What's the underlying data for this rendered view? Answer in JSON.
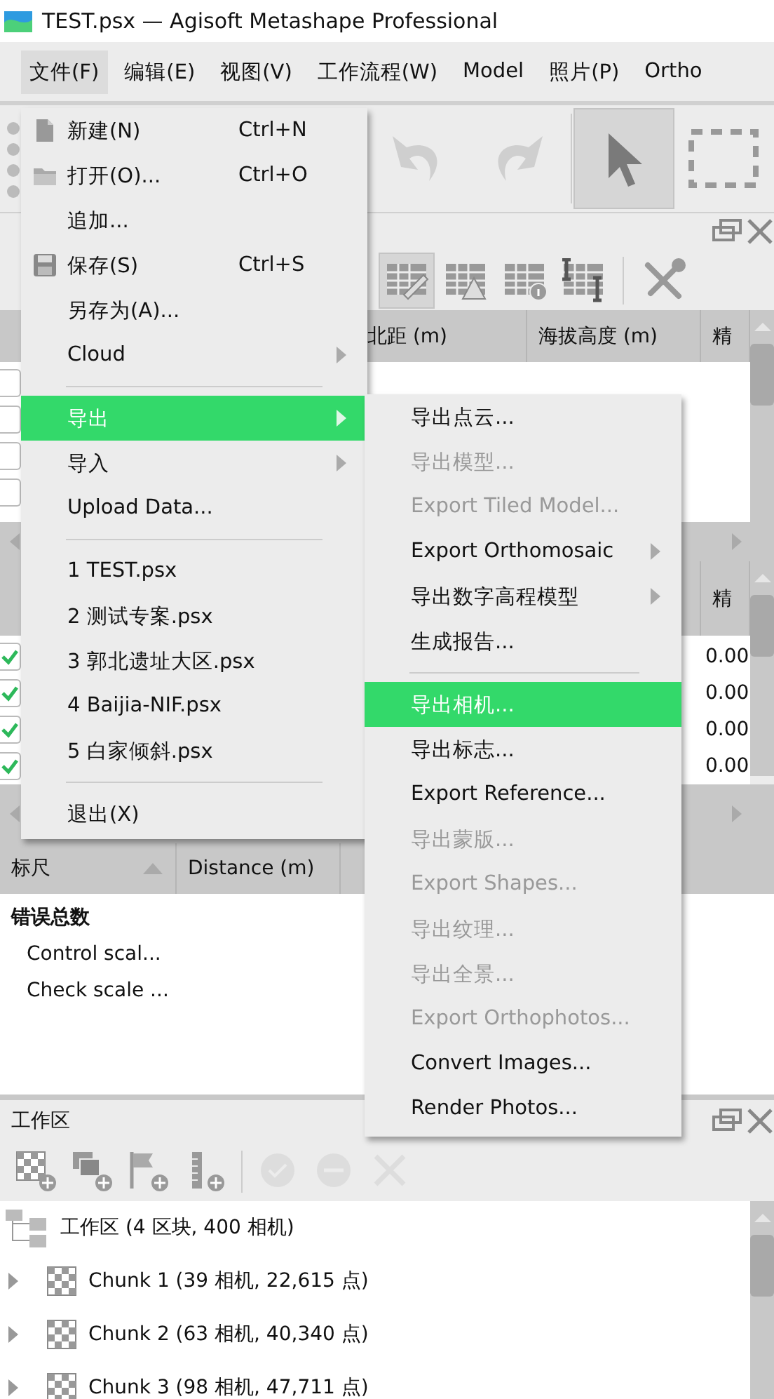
{
  "window": {
    "title": "TEST.psx — Agisoft Metashape Professional"
  },
  "menubar": [
    {
      "label": "文件(F)",
      "selected": true
    },
    {
      "label": "编辑(E)",
      "selected": false
    },
    {
      "label": "视图(V)",
      "selected": false
    },
    {
      "label": "工作流程(W)",
      "selected": false
    },
    {
      "label": "Model",
      "selected": false
    },
    {
      "label": "照片(P)",
      "selected": false
    },
    {
      "label": "Ortho",
      "selected": false
    }
  ],
  "toolbar": [
    {
      "kind": "undo",
      "selected": false
    },
    {
      "kind": "redo",
      "selected": false
    },
    {
      "kind": "separator"
    },
    {
      "kind": "pointer",
      "selected": true
    },
    {
      "kind": "rect-select",
      "selected": false
    }
  ],
  "reference_panel": {
    "toolbar": [
      {
        "kind": "edit",
        "selected": true
      },
      {
        "kind": "warning",
        "selected": false
      },
      {
        "kind": "info",
        "selected": false
      },
      {
        "kind": "columns",
        "selected": false
      },
      {
        "kind": "separator"
      },
      {
        "kind": "tools",
        "selected": false
      }
    ],
    "top_table": {
      "columns": [
        "北距 (m)",
        "海拔高度 (m)",
        "精"
      ],
      "rows": [
        {
          "checked": false
        },
        {
          "checked": false
        },
        {
          "checked": false
        },
        {
          "checked": false
        }
      ]
    },
    "bottom_table": {
      "columns": [
        "精"
      ],
      "rows": [
        {
          "checked": true,
          "column_2": "0.00"
        },
        {
          "checked": true,
          "column_2": "0.00"
        },
        {
          "checked": true,
          "column_2": "0.00"
        },
        {
          "checked": true,
          "column_2": "0.00"
        }
      ]
    }
  },
  "scale_panel": {
    "columns": [
      "标尺",
      "Distance (m)"
    ],
    "rows": [
      {
        "kind": "group",
        "label": "错误总数"
      },
      {
        "kind": "item",
        "label": "Control scal..."
      },
      {
        "kind": "item",
        "label": "Check scale ..."
      }
    ]
  },
  "workspace": {
    "title": "工作区",
    "toolbar": [
      {
        "kind": "add-chunk",
        "disabled": false
      },
      {
        "kind": "add-photos",
        "disabled": false
      },
      {
        "kind": "add-marker",
        "disabled": false
      },
      {
        "kind": "add-scale",
        "disabled": false
      },
      {
        "kind": "separator"
      },
      {
        "kind": "check",
        "disabled": true
      },
      {
        "kind": "minus",
        "disabled": true
      },
      {
        "kind": "cross",
        "disabled": true
      }
    ],
    "tree": {
      "label": "工作区 (4 区块, 400 相机)",
      "children": [
        {
          "label": "Chunk 1 (39 相机, 22,615 点)",
          "expanded": false
        },
        {
          "label": "Chunk 2 (63 相机, 40,340 点)",
          "expanded": false
        },
        {
          "label": "Chunk 3 (98 相机, 47,711 点)",
          "expanded": false
        }
      ]
    }
  },
  "file_menu": {
    "items": [
      {
        "kind": "new",
        "label": "新建(N)",
        "shortcut": "Ctrl+N",
        "selected": false
      },
      {
        "kind": "open",
        "label": "打开(O)...",
        "shortcut": "Ctrl+O",
        "selected": false
      },
      {
        "kind": "command",
        "label": "追加...",
        "selected": false
      },
      {
        "kind": "save",
        "label": "保存(S)",
        "shortcut": "Ctrl+S",
        "selected": false
      },
      {
        "kind": "command",
        "label": "另存为(A)...",
        "selected": false
      },
      {
        "kind": "submenu",
        "label": "Cloud",
        "selected": false
      },
      {
        "kind": "separator"
      },
      {
        "kind": "submenu",
        "label": "导出",
        "selected": true
      },
      {
        "kind": "submenu",
        "label": "导入",
        "selected": false
      },
      {
        "kind": "command",
        "label": "Upload Data...",
        "selected": false
      },
      {
        "kind": "separator"
      },
      {
        "kind": "command",
        "label": "1 TEST.psx",
        "selected": false
      },
      {
        "kind": "command",
        "label": "2 测试专案.psx",
        "selected": false
      },
      {
        "kind": "command",
        "label": "3 郭北遗址大区.psx",
        "selected": false
      },
      {
        "kind": "command",
        "label": "4 Baijia-NIF.psx",
        "selected": false
      },
      {
        "kind": "command",
        "label": "5 白家倾斜.psx",
        "selected": false
      },
      {
        "kind": "separator"
      },
      {
        "kind": "command",
        "label": "退出(X)",
        "selected": false
      }
    ]
  },
  "export_menu": {
    "items": [
      {
        "kind": "command",
        "label": "导出点云...",
        "disabled": false,
        "selected": false
      },
      {
        "kind": "command",
        "label": "导出模型...",
        "disabled": true,
        "selected": false
      },
      {
        "kind": "command",
        "label": "Export Tiled Model...",
        "disabled": true,
        "selected": false
      },
      {
        "kind": "submenu",
        "label": "Export Orthomosaic",
        "disabled": false,
        "selected": false
      },
      {
        "kind": "submenu",
        "label": "导出数字高程模型",
        "disabled": false,
        "selected": false
      },
      {
        "kind": "command",
        "label": "生成报告...",
        "disabled": false,
        "selected": false
      },
      {
        "kind": "separator"
      },
      {
        "kind": "command",
        "label": "导出相机...",
        "disabled": false,
        "selected": true
      },
      {
        "kind": "command",
        "label": "导出标志...",
        "disabled": false,
        "selected": false
      },
      {
        "kind": "command",
        "label": "Export Reference...",
        "disabled": false,
        "selected": false
      },
      {
        "kind": "command",
        "label": "导出蒙版...",
        "disabled": true,
        "selected": false
      },
      {
        "kind": "command",
        "label": "Export Shapes...",
        "disabled": true,
        "selected": false
      },
      {
        "kind": "command",
        "label": "导出纹理...",
        "disabled": true,
        "selected": false
      },
      {
        "kind": "command",
        "label": "导出全景...",
        "disabled": true,
        "selected": false
      },
      {
        "kind": "command",
        "label": "Export Orthophotos...",
        "disabled": true,
        "selected": false
      },
      {
        "kind": "command",
        "label": "Convert Images...",
        "disabled": false,
        "selected": false
      },
      {
        "kind": "command",
        "label": "Render Photos...",
        "disabled": false,
        "selected": false
      }
    ]
  }
}
